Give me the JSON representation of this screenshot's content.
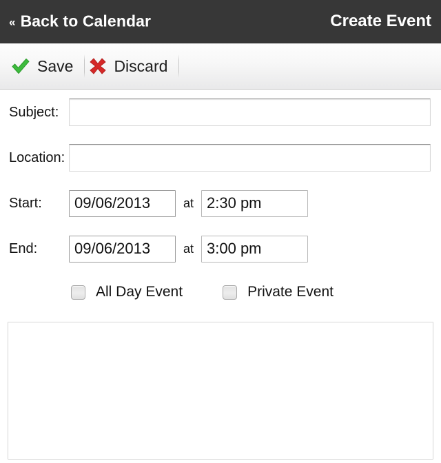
{
  "header": {
    "back_chevrons": "«",
    "back_label": "Back to Calendar",
    "title": "Create Event"
  },
  "toolbar": {
    "save_label": "Save",
    "discard_label": "Discard",
    "save_icon": "green-check-icon",
    "discard_icon": "red-x-icon",
    "save_icon_color": "#3dbb3d",
    "discard_icon_color": "#d62828"
  },
  "form": {
    "subject": {
      "label": "Subject:",
      "value": "",
      "placeholder": ""
    },
    "location": {
      "label": "Location:",
      "value": "",
      "placeholder": ""
    },
    "start": {
      "label": "Start:",
      "date": "09/06/2013",
      "at": "at",
      "time": "2:30 pm"
    },
    "end": {
      "label": "End:",
      "date": "09/06/2013",
      "at": "at",
      "time": "3:00 pm"
    },
    "all_day": {
      "label": "All Day Event",
      "checked": false
    },
    "private": {
      "label": "Private Event",
      "checked": false
    },
    "notes": {
      "value": "",
      "placeholder": ""
    }
  },
  "colors": {
    "header_bg": "#373737",
    "toolbar_bg": "#f2f2f2",
    "page_bg": "#ffffff",
    "text": "#111111"
  }
}
